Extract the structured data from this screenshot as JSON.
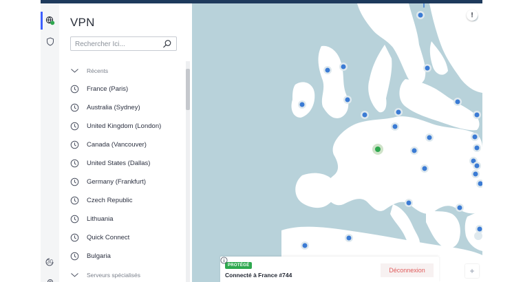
{
  "sidebar": {
    "title": "VPN",
    "search_placeholder": "Rechercher Ici...",
    "items": [
      {
        "icon": "chevron-down-icon",
        "label": "Récents",
        "muted": true
      },
      {
        "icon": "clock-icon",
        "label": "France (Paris)"
      },
      {
        "icon": "clock-icon",
        "label": "Australia (Sydney)"
      },
      {
        "icon": "clock-icon",
        "label": "United Kingdom (London)"
      },
      {
        "icon": "clock-icon",
        "label": "Canada (Vancouver)"
      },
      {
        "icon": "clock-icon",
        "label": "United States (Dallas)"
      },
      {
        "icon": "clock-icon",
        "label": "Germany (Frankfurt)"
      },
      {
        "icon": "clock-icon",
        "label": "Czech Republic"
      },
      {
        "icon": "clock-icon",
        "label": "Lithuania"
      },
      {
        "icon": "clock-icon",
        "label": "Quick Connect"
      },
      {
        "icon": "clock-icon",
        "label": "Bulgaria"
      },
      {
        "icon": "chevron-down-icon",
        "label": "Serveurs spécialisés",
        "muted": true
      }
    ]
  },
  "rail": {
    "vpn_icon": "globe-shield-icon",
    "shield_icon": "shield-icon",
    "timer_label": "30"
  },
  "map": {
    "info_label": "!",
    "zoom_label": "+"
  },
  "status": {
    "badge": "PROTÉGÉ",
    "connection": "Connecté à France #744",
    "disconnect_label": "Déconnexion"
  },
  "colors": {
    "accent": "#3e5fff",
    "server_dot": "#3b7bd4",
    "connected_dot": "#2fa84f",
    "protected_badge": "#2fa84f",
    "disconnect_text": "#e05b5b"
  }
}
